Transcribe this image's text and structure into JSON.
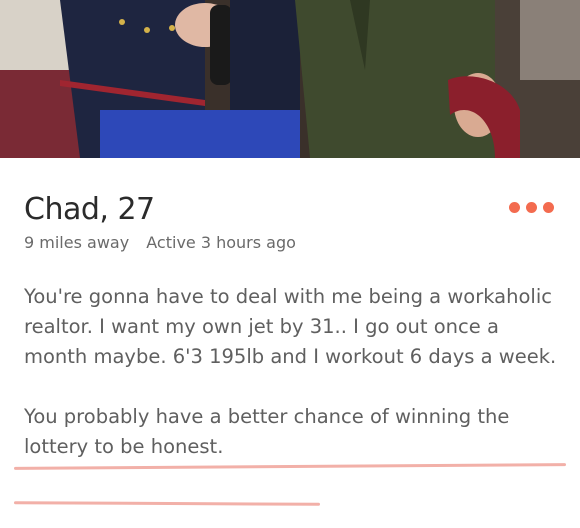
{
  "photo": {
    "icon": "profile-photo"
  },
  "profile": {
    "name_age": "Chad, 27",
    "distance": "9 miles away",
    "active": "Active 3 hours ago",
    "bio_paragraph_1": "You're gonna have to deal with me being a workaholic realtor. I want my own jet by 31.. I go out once a month maybe. 6'3 195lb and I workout 6 days a week.",
    "bio_paragraph_2": "You probably have a better chance of winning the lottery to be honest."
  },
  "colors": {
    "accent": "#f36b4f",
    "underline": "#f2b0a8"
  },
  "more_menu": {
    "icon": "more-options-icon"
  }
}
